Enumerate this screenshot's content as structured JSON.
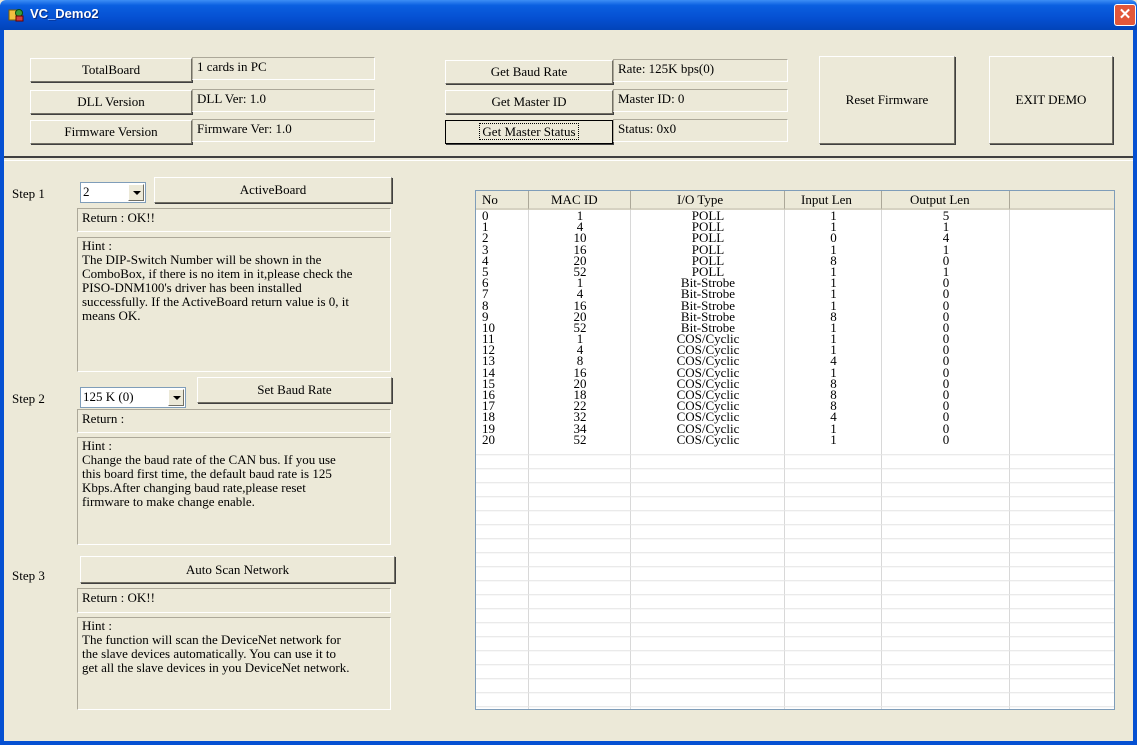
{
  "window": {
    "title": "VC_Demo2",
    "close_glyph": "✕"
  },
  "info_panel": {
    "total_board_label": "TotalBoard",
    "total_board_value": "1 cards in PC",
    "dll_version_label": "DLL Version",
    "dll_version_value": "DLL Ver: 1.0",
    "firmware_version_label": "Firmware Version",
    "firmware_version_value": "Firmware Ver: 1.0",
    "get_baud_rate_label": "Get Baud Rate",
    "baud_rate_value": "Rate: 125K bps(0)",
    "get_master_id_label": "Get Master ID",
    "master_id_value": "Master ID: 0",
    "get_master_status_label": "Get Master Status",
    "master_status_value": "Status: 0x0",
    "reset_firmware_label": "Reset Firmware",
    "exit_demo_label": "EXIT DEMO"
  },
  "step1": {
    "label": "Step 1",
    "combo_value": "2",
    "button_label": "ActiveBoard",
    "return_text": "Return : OK!!",
    "hint_text": "Hint :\nThe DIP-Switch Number will be shown in the\nComboBox, if there is no item in it,please check the\nPISO-DNM100's driver has been installed\nsuccessfully. If the ActiveBoard return value is 0, it\nmeans OK."
  },
  "step2": {
    "label": "Step 2",
    "combo_value": "125 K (0)",
    "button_label": "Set Baud Rate",
    "return_text": "Return :",
    "hint_text": "Hint :\nChange the baud rate of the CAN bus. If you use\nthis board first time, the default baud rate is 125\nKbps.After changing baud rate,please reset\nfirmware to make change enable."
  },
  "step3": {
    "label": "Step 3",
    "button_label": "Auto Scan Network",
    "return_text": "Return : OK!!",
    "hint_text": "Hint :\nThe function will scan the DeviceNet network for\nthe slave devices automatically. You can use it to\nget all the slave devices in you DeviceNet network."
  },
  "device_table": {
    "columns": [
      "No",
      "MAC ID",
      "I/O Type",
      "Input Len",
      "Output Len",
      ""
    ],
    "rows": [
      [
        "0",
        "1",
        "POLL",
        "1",
        "5"
      ],
      [
        "1",
        "4",
        "POLL",
        "1",
        "1"
      ],
      [
        "2",
        "10",
        "POLL",
        "0",
        "4"
      ],
      [
        "3",
        "16",
        "POLL",
        "1",
        "1"
      ],
      [
        "4",
        "20",
        "POLL",
        "8",
        "0"
      ],
      [
        "5",
        "52",
        "POLL",
        "1",
        "1"
      ],
      [
        "6",
        "1",
        "Bit-Strobe",
        "1",
        "0"
      ],
      [
        "7",
        "4",
        "Bit-Strobe",
        "1",
        "0"
      ],
      [
        "8",
        "16",
        "Bit-Strobe",
        "1",
        "0"
      ],
      [
        "9",
        "20",
        "Bit-Strobe",
        "8",
        "0"
      ],
      [
        "10",
        "52",
        "Bit-Strobe",
        "1",
        "0"
      ],
      [
        "11",
        "1",
        "COS/Cyclic",
        "1",
        "0"
      ],
      [
        "12",
        "4",
        "COS/Cyclic",
        "1",
        "0"
      ],
      [
        "13",
        "8",
        "COS/Cyclic",
        "4",
        "0"
      ],
      [
        "14",
        "16",
        "COS/Cyclic",
        "1",
        "0"
      ],
      [
        "15",
        "20",
        "COS/Cyclic",
        "8",
        "0"
      ],
      [
        "16",
        "18",
        "COS/Cyclic",
        "8",
        "0"
      ],
      [
        "17",
        "22",
        "COS/Cyclic",
        "8",
        "0"
      ],
      [
        "18",
        "32",
        "COS/Cyclic",
        "4",
        "0"
      ],
      [
        "19",
        "34",
        "COS/Cyclic",
        "1",
        "0"
      ],
      [
        "20",
        "52",
        "COS/Cyclic",
        "1",
        "0"
      ]
    ]
  }
}
